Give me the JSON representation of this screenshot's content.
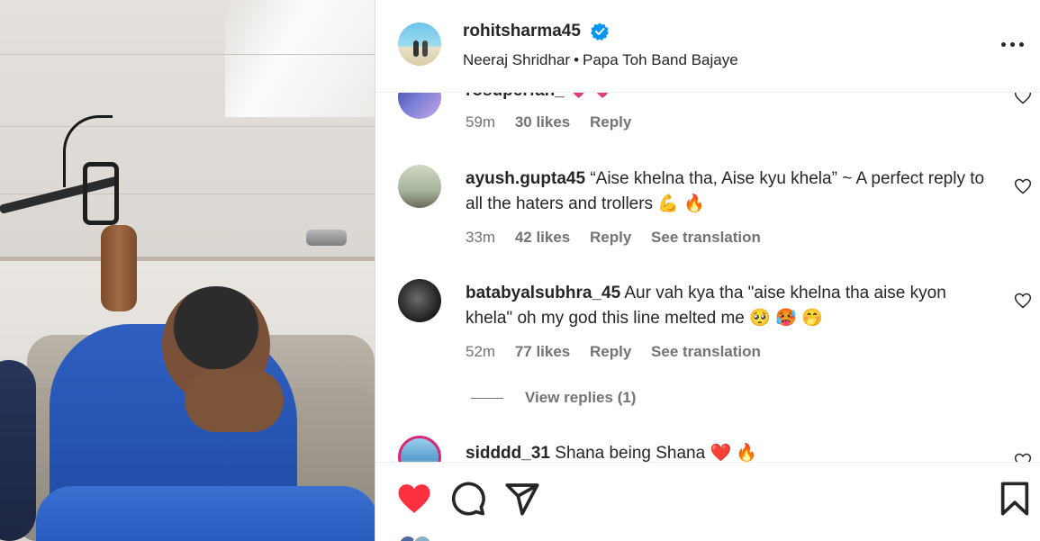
{
  "post": {
    "username": "rohitsharma45",
    "verified": true,
    "collaborator": "Neeraj Shridhar",
    "separator": "•",
    "audio": "Papa Toh Band Bajaye",
    "more_icon": "more-horizontal-icon"
  },
  "comments": [
    {
      "handle": "rosuperfan_",
      "text": "💗 💗",
      "time": "59m",
      "likes": "30 likes",
      "reply": "Reply",
      "translate": ""
    },
    {
      "handle": "ayush.gupta45",
      "text": "“Aise khelna tha, Aise kyu khela” ~ A perfect reply to all the haters and trollers 💪 🔥",
      "time": "33m",
      "likes": "42 likes",
      "reply": "Reply",
      "translate": "See translation"
    },
    {
      "handle": "batabyalsubhra_45",
      "text": "Aur vah kya tha \"aise khelna tha aise kyon khela\" oh my god this line melted me 🥺 🥵 🤭",
      "time": "52m",
      "likes": "77 likes",
      "reply": "Reply",
      "translate": "See translation"
    },
    {
      "handle": "sidddd_31",
      "text": "Shana being Shana ❤️ 🔥",
      "time": "",
      "likes": "",
      "reply": "",
      "translate": ""
    }
  ],
  "view_replies": "View replies (1)",
  "actions": {
    "like_icon": "heart-filled-icon",
    "comment_icon": "comment-icon",
    "share_icon": "share-icon",
    "save_icon": "bookmark-icon",
    "liked": true
  },
  "colors": {
    "like_red": "#ff3040",
    "verified_blue": "#0095f6",
    "secondary_text": "#737373",
    "primary_text": "#262626"
  }
}
